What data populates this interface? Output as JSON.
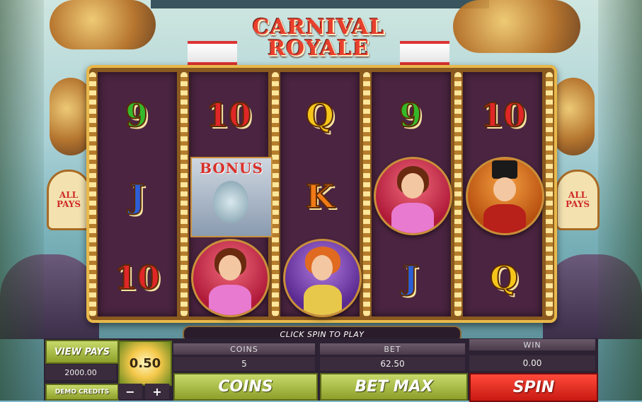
{
  "game": {
    "title_line1": "CARNIVAL",
    "title_line2": "ROYALE",
    "side_sign_left": "ALL PAYS",
    "side_sign_right": "ALL PAYS"
  },
  "reels": [
    [
      "9",
      "J",
      "10"
    ],
    [
      "10",
      "BONUS",
      "showgirl-red"
    ],
    [
      "Q",
      "K",
      "showgirl-purple"
    ],
    [
      "9",
      "showgirl-red",
      "J"
    ],
    [
      "10",
      "ringmaster",
      "Q"
    ]
  ],
  "symbols": {
    "r0_0": "9",
    "r0_1": "J",
    "r0_2": "10",
    "r1_0": "10",
    "r1_1": "BONUS",
    "r2_0": "Q",
    "r2_1": "K",
    "r3_0": "9",
    "r3_2": "J",
    "r4_0": "10",
    "r4_2": "Q"
  },
  "message": "CLICK SPIN TO PLAY",
  "controls": {
    "view_pays": "VIEW PAYS",
    "credits_value": "2000.00",
    "credits_label": "DEMO CREDITS",
    "coin_value": "0.50",
    "minus": "−",
    "plus": "+",
    "coins_label": "COINS",
    "coins_value": "5",
    "coins_button": "COINS",
    "bet_label": "BET",
    "bet_value": "62.50",
    "bet_max_button": "BET MAX",
    "win_label": "WIN",
    "win_value": "0.00",
    "spin_button": "SPIN"
  },
  "colors": {
    "spin": "#e2231a",
    "green_button": "#a8bb3a",
    "reel_background": "#4a2440"
  }
}
